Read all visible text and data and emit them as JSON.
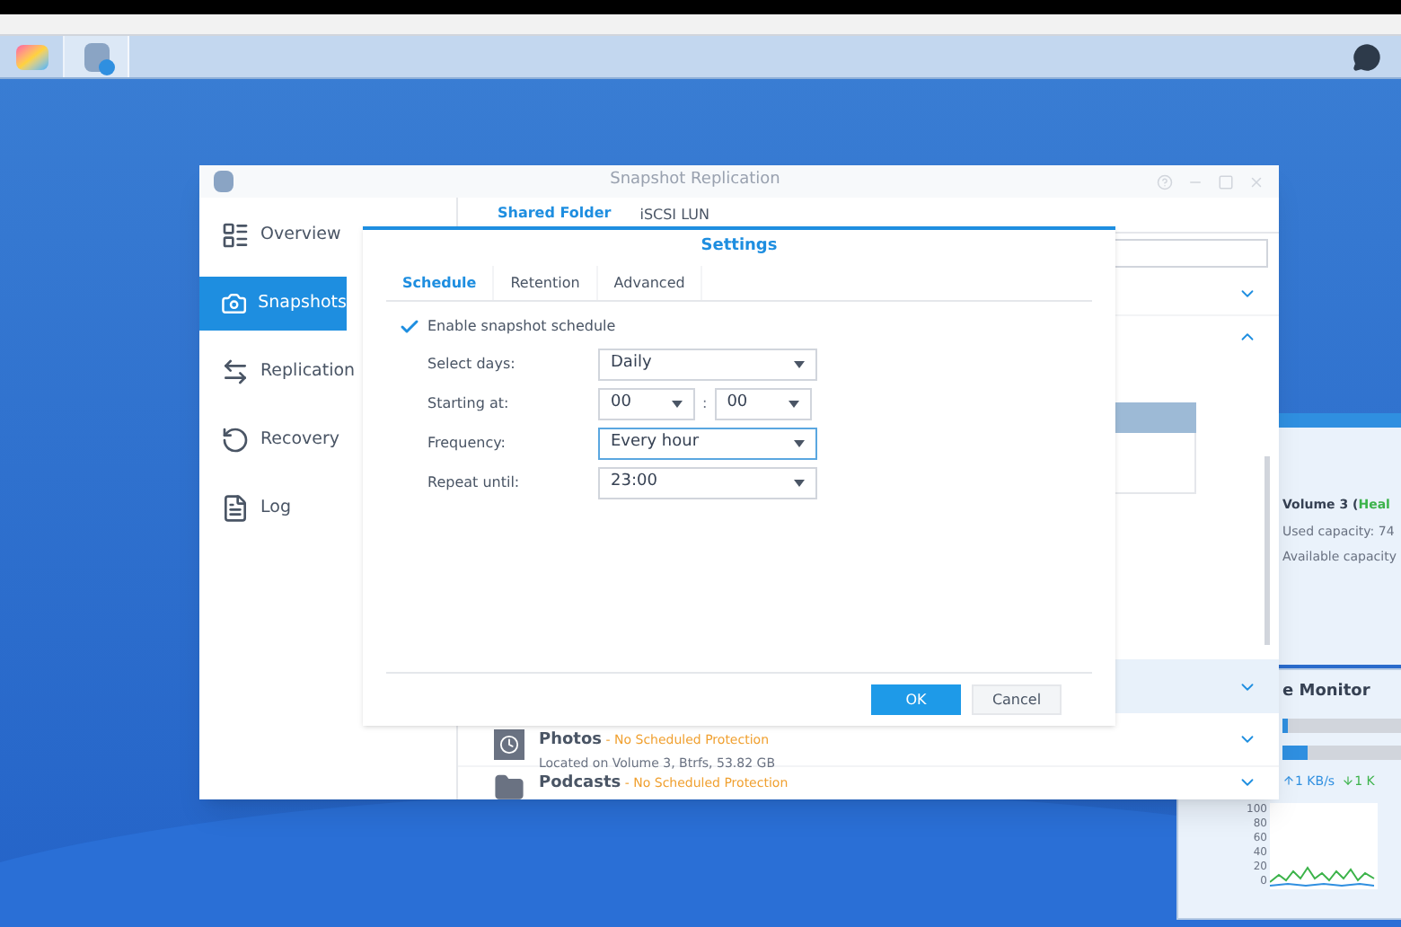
{
  "main_window": {
    "title": "Snapshot Replication",
    "sidebar": {
      "items": [
        {
          "label": "Overview",
          "selected": false
        },
        {
          "label": "Snapshots",
          "selected": true
        },
        {
          "label": "Replication",
          "selected": false
        },
        {
          "label": "Recovery",
          "selected": false
        },
        {
          "label": "Log",
          "selected": false
        }
      ]
    },
    "tabs": [
      {
        "label": "Shared Folder",
        "selected": true
      },
      {
        "label": "iSCSI LUN",
        "selected": false
      }
    ],
    "folders": [
      {
        "name": "Photos",
        "status": " - No Scheduled Protection",
        "detail": "Located on Volume 3, Btrfs, 53.82 GB",
        "expanded": false
      },
      {
        "name": "Podcasts",
        "status": " - No Scheduled Protection",
        "expanded": false
      }
    ]
  },
  "dialog": {
    "title": "Settings",
    "tabs": [
      {
        "label": "Schedule",
        "selected": true
      },
      {
        "label": "Retention",
        "selected": false
      },
      {
        "label": "Advanced",
        "selected": false
      }
    ],
    "enable_schedule": {
      "label": "Enable snapshot schedule",
      "checked": true
    },
    "fields": [
      {
        "label": "Select days:",
        "kind": "select",
        "value": "Daily",
        "focused": false
      },
      {
        "label": "Starting at:",
        "kind": "time",
        "hour": "00",
        "separator": ":",
        "minute": "00",
        "focused": false
      },
      {
        "label": "Frequency:",
        "kind": "select",
        "value": "Every hour",
        "focused": true
      },
      {
        "label": "Repeat until:",
        "kind": "select",
        "value": "23:00",
        "focused": false
      }
    ],
    "buttons": [
      {
        "label": "OK",
        "kind": "primary"
      },
      {
        "label": "Cancel",
        "kind": "secondary"
      }
    ]
  },
  "storage_widget": {
    "volume": "Volume 3 (",
    "health": "Heal",
    "used": "Used capacity: 74",
    "available": "Available capacity"
  },
  "resource_monitor": {
    "title": "e Monitor",
    "upload": "1 KB/s",
    "download": "1 K",
    "y_labels": [
      "100",
      "80",
      "60",
      "40",
      "20",
      "0"
    ]
  }
}
